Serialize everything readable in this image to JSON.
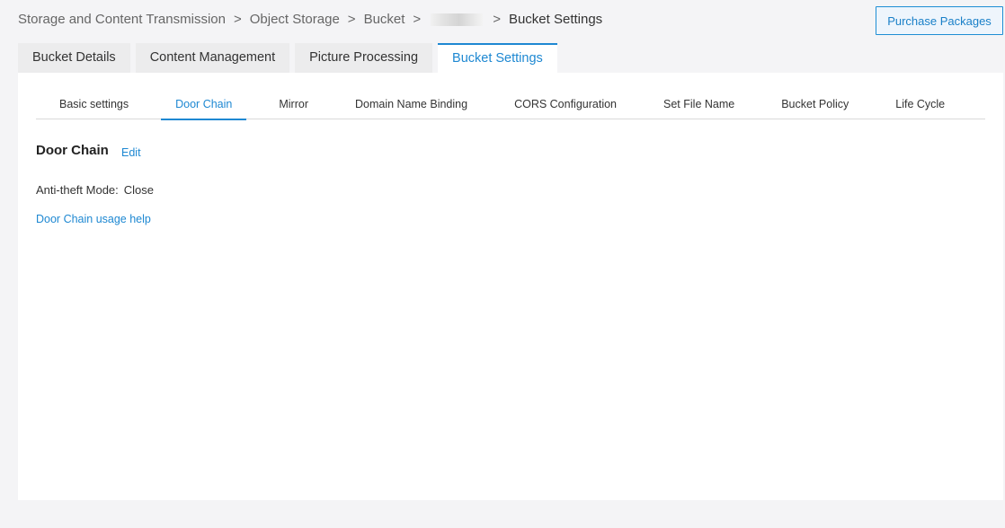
{
  "breadcrumb": {
    "items": [
      "Storage and Content Transmission",
      "Object Storage",
      "Bucket"
    ],
    "separator": ">",
    "current": "Bucket Settings"
  },
  "header": {
    "purchase_label": "Purchase Packages"
  },
  "top_tabs": [
    {
      "label": "Bucket Details"
    },
    {
      "label": "Content Management"
    },
    {
      "label": "Picture Processing"
    },
    {
      "label": "Bucket Settings",
      "active": true
    }
  ],
  "sub_tabs": [
    {
      "label": "Basic settings"
    },
    {
      "label": "Door Chain",
      "active": true
    },
    {
      "label": "Mirror"
    },
    {
      "label": "Domain Name Binding"
    },
    {
      "label": "CORS Configuration"
    },
    {
      "label": "Set File Name"
    },
    {
      "label": "Bucket Policy"
    },
    {
      "label": "Life Cycle"
    }
  ],
  "section": {
    "title": "Door Chain",
    "edit_label": "Edit",
    "field_label": "Anti-theft Mode:",
    "field_value": "Close",
    "help_link": "Door Chain usage help"
  },
  "colors": {
    "accent": "#1e88d2",
    "page_bg": "#f4f4f6",
    "tab_bg": "#ececed"
  }
}
